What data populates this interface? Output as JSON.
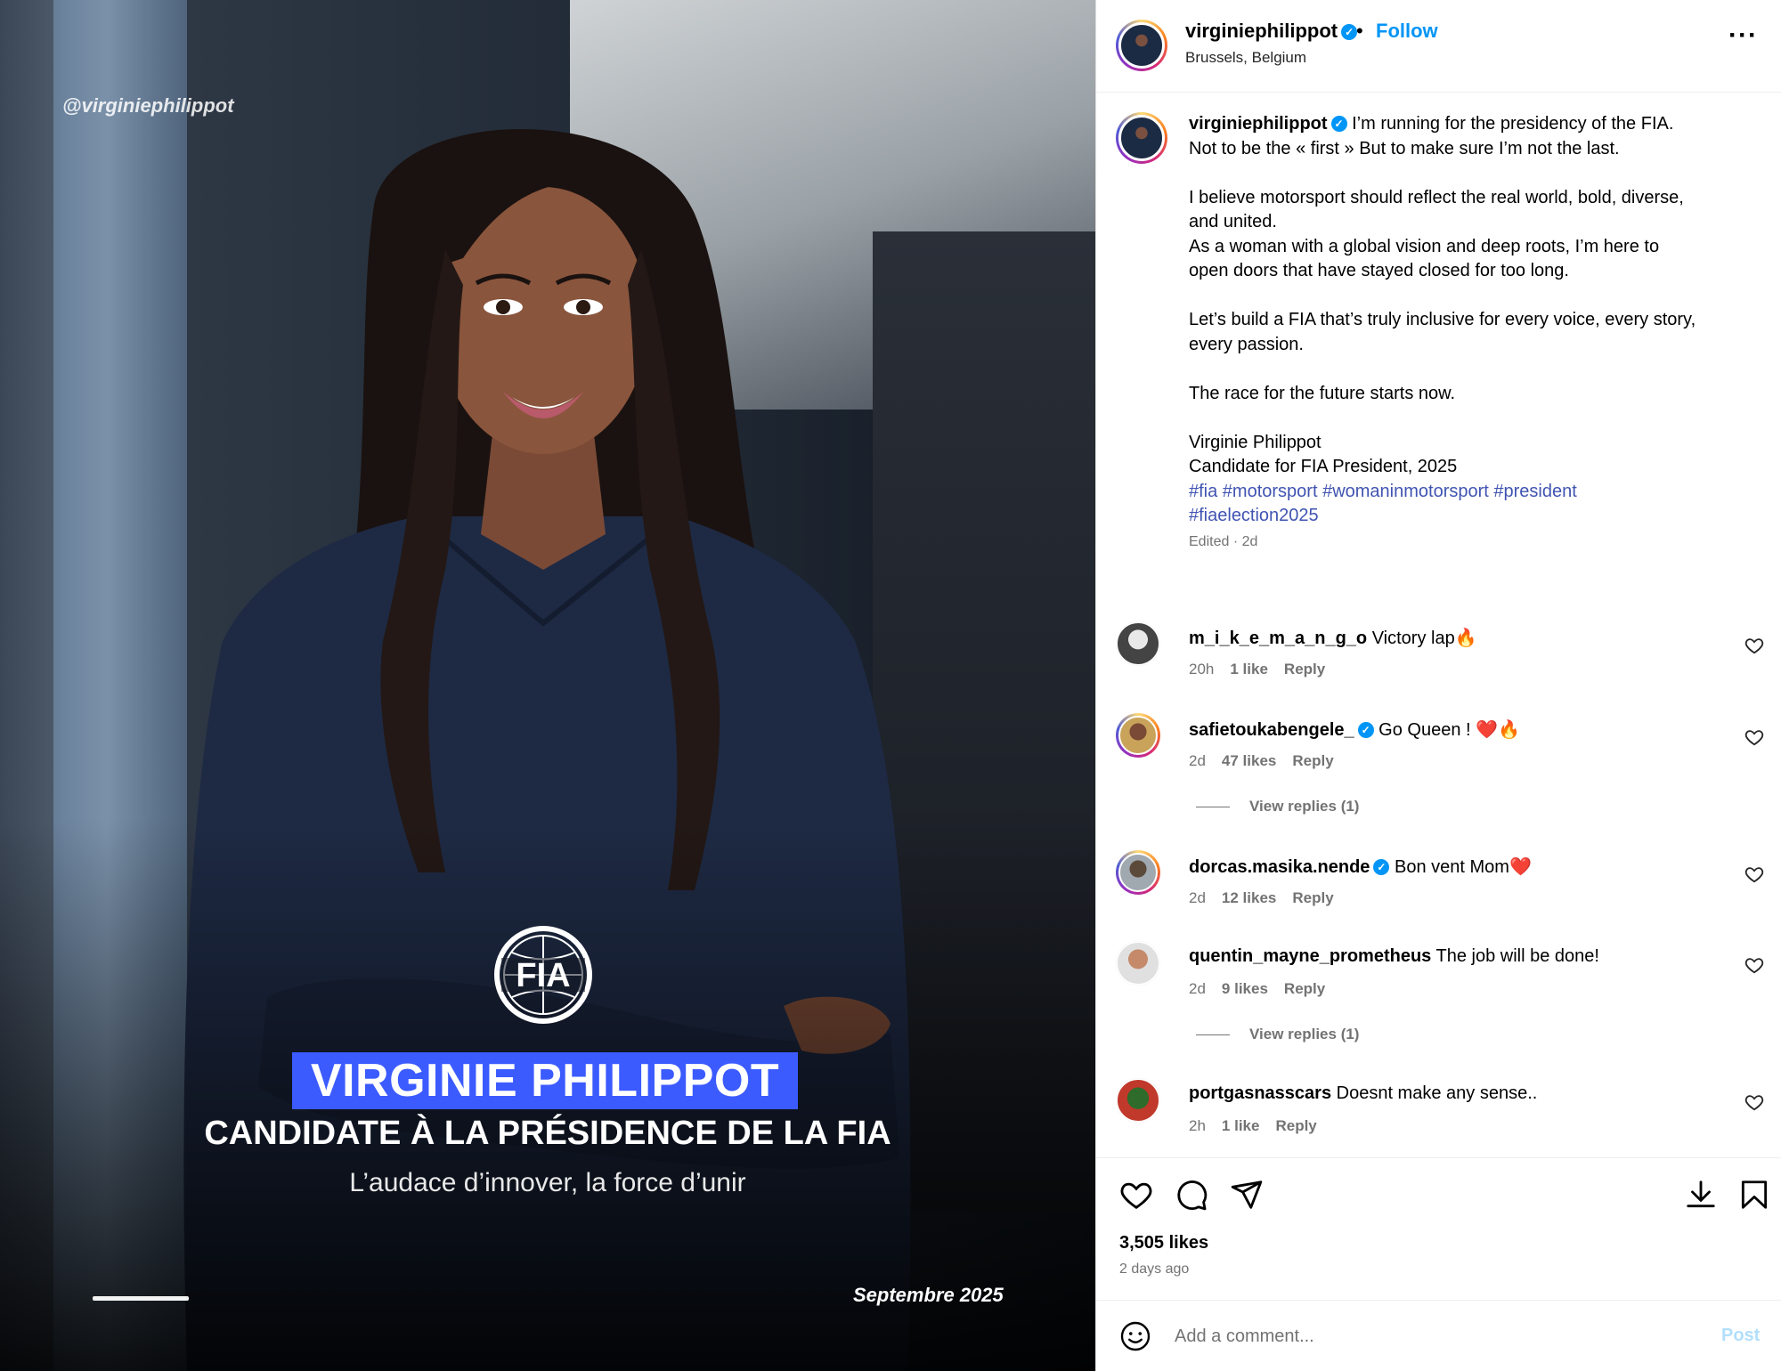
{
  "media": {
    "watermark": "@virginiephilippot",
    "name_banner": "VIRGINIE PHILIPPOT",
    "subtitle": "CANDIDATE À LA PRÉSIDENCE DE LA FIA",
    "tagline": "L’audace d’innover, la force d’unir",
    "date": "Septembre 2025",
    "logo_text": "FIA"
  },
  "header": {
    "username": "virginiephilippot",
    "location": "Brussels, Belgium",
    "separator": "•",
    "follow_label": "Follow",
    "more_label": "···"
  },
  "caption": {
    "username": "virginiephilippot",
    "line1": " I’m running for the presidency of the FIA.",
    "body": "Not to be the « first » But to make sure I’m not the last.\n\nI believe motorsport should reflect the real world, bold, diverse,\nand united.\nAs a woman with a global vision and deep roots, I’m here to\nopen doors that have stayed closed for too long.\n\nLet’s build a FIA that’s truly inclusive for every voice, every story,\nevery passion.\n\nThe race for the future starts now.\n\nVirginie Philippot\nCandidate for FIA President, 2025\n",
    "hashtags": "#fia #motorsport #womaninmotorsport #president\n#fiaelection2025",
    "meta": "Edited · 2d"
  },
  "comments": [
    {
      "user": "m_i_k_e_m_a_n_g_o",
      "text": " Victory lap🔥",
      "time": "20h",
      "likes": "1 like",
      "reply": "Reply",
      "verified": false
    },
    {
      "user": "safietoukabengele_",
      "text": " Go Queen ! ❤️🔥",
      "time": "2d",
      "likes": "47 likes",
      "reply": "Reply",
      "verified": true,
      "view_replies": "View replies (1)"
    },
    {
      "user": "dorcas.masika.nende",
      "text": " Bon vent Mom❤️",
      "time": "2d",
      "likes": "12 likes",
      "reply": "Reply",
      "verified": true
    },
    {
      "user": "quentin_mayne_prometheus",
      "text": " The job will be done!",
      "time": "2d",
      "likes": "9 likes",
      "reply": "Reply",
      "verified": false,
      "view_replies": "View replies (1)"
    },
    {
      "user": "portgasnasscars",
      "text": " Doesnt make any sense..",
      "time": "2h",
      "likes": "1 like",
      "reply": "Reply",
      "verified": false
    }
  ],
  "footer": {
    "likes_count": "3,505 likes",
    "time_ago": "2 days ago",
    "comment_placeholder": "Add a comment...",
    "post_label": "Post"
  },
  "colors": {
    "accent": "#0095f6",
    "banner_blue": "#3b5bff",
    "hashtag": "#4054b2"
  }
}
